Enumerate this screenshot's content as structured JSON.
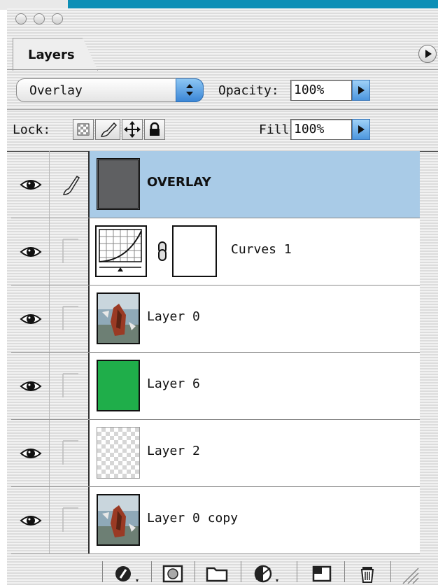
{
  "panel": {
    "tab_label": "Layers",
    "blend_mode": "Overlay",
    "opacity_label": "Opacity:",
    "opacity_value": "100%",
    "lock_label": "Lock:",
    "fill_label": "Fill:",
    "fill_value": "100%"
  },
  "colors": {
    "accent": "#0d8fb6",
    "selected_row": "#a9cbe7",
    "overlay_swatch": "#5f6062",
    "green_swatch": "#1fae4a"
  },
  "layers": [
    {
      "name": "OVERLAY",
      "selected": true,
      "thumb": "gray-fill",
      "link_icon": "brush-icon"
    },
    {
      "name": "Curves 1",
      "selected": false,
      "thumb": "curves-adjustment",
      "mask": "white-mask"
    },
    {
      "name": "Layer 0",
      "selected": false,
      "thumb": "photo"
    },
    {
      "name": "Layer 6",
      "selected": false,
      "thumb": "green-fill"
    },
    {
      "name": "Layer 2",
      "selected": false,
      "thumb": "transparent"
    },
    {
      "name": "Layer 0 copy",
      "selected": false,
      "thumb": "photo"
    }
  ],
  "icons": {
    "window_lights": [
      "close-light",
      "minimize-light",
      "zoom-light"
    ],
    "lock": [
      "lock-transparency-icon",
      "lock-brush-icon",
      "lock-move-icon",
      "lock-all-icon"
    ],
    "bottom": [
      "layer-style-icon",
      "add-mask-icon",
      "new-group-icon",
      "adjustment-layer-icon",
      "new-layer-icon",
      "trash-icon"
    ]
  }
}
